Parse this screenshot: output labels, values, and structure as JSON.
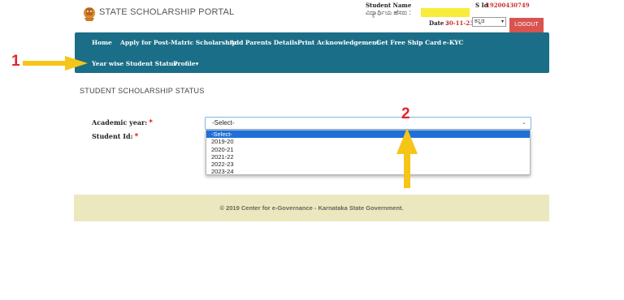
{
  "header": {
    "portal_title": "STATE SCHOLARSHIP PORTAL",
    "student_name_label": "Student Name",
    "student_name_kannada": "ವಿದ್ಯಾರ್ಥಿಯ ಹೆಸರು :",
    "sid_label": "S Id",
    "sid_value": "19200430749",
    "date_label": "Date :",
    "date_value": "30-11-23",
    "language_selected": "ಕನ್ನಡ",
    "logout_label": "LOGOUT"
  },
  "nav": {
    "items": [
      {
        "label": "Home"
      },
      {
        "label": "Apply for Post-Matric Scholarship"
      },
      {
        "label": "Add Parents Details"
      },
      {
        "label": "Print Acknowledgement"
      },
      {
        "label": "Get Free Ship Card"
      },
      {
        "label": "e-KYC"
      },
      {
        "label": "Year wise Student Status"
      },
      {
        "label": "Profile▾"
      }
    ]
  },
  "page": {
    "title": "STUDENT SCHOLARSHIP STATUS"
  },
  "form": {
    "academic_year_label": "Academic year:",
    "student_id_label": "Student Id:",
    "required_mark": "*",
    "academic_year_value": "-Select-",
    "dropdown_options": [
      "-Select-",
      "2019-20",
      "2020-21",
      "2021-22",
      "2022-23",
      "2023-24"
    ]
  },
  "footer": {
    "text": "© 2019 Center for e-Governance - Karnataka State Government."
  },
  "annotations": {
    "step1": "1",
    "step2": "2"
  },
  "colors": {
    "nav_bg": "#1b6e87",
    "logout_bg": "#d9534f",
    "footer_bg": "#ebe8bf",
    "highlight": "#f7ec3a",
    "arrow": "#f5c518",
    "annotation_number": "#e3242b",
    "dropdown_selected": "#1e6fd9"
  }
}
